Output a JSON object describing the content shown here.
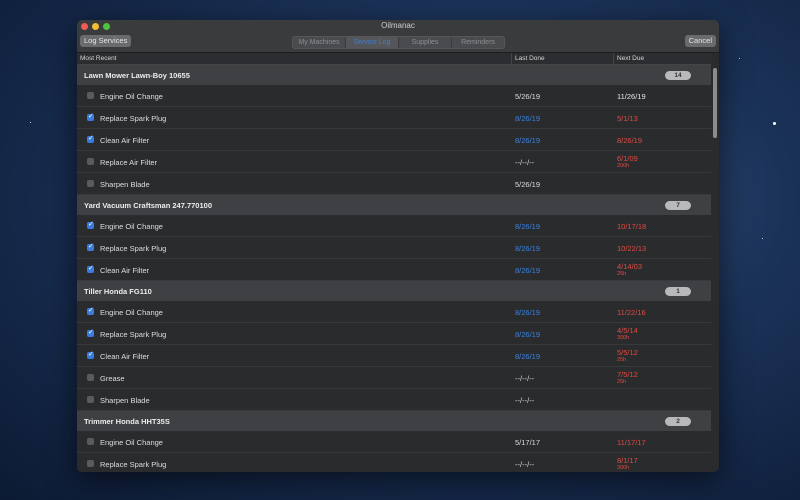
{
  "window": {
    "title": "Oilmanac"
  },
  "toolbar": {
    "log_services_label": "Log Services",
    "cancel_label": "Cancel",
    "tabs": [
      "My Machines",
      "Service Log",
      "Supplies",
      "Reminders"
    ]
  },
  "columns": {
    "most_recent": "Most Recent",
    "last_done": "Last Done",
    "next_due": "Next Due"
  },
  "groups": [
    {
      "title": "Lawn Mower   Lawn-Boy 10655",
      "badge": "14",
      "rows": [
        {
          "service": "Engine Oil Change",
          "checked": false,
          "last": "5/26/19",
          "next": "11/26/19",
          "next_color": "white"
        },
        {
          "service": "Replace Spark Plug",
          "checked": true,
          "last": "8/26/19",
          "next": "5/1/13",
          "next_color": "red"
        },
        {
          "service": "Clean Air Filter",
          "checked": true,
          "last": "8/26/19",
          "next": "8/26/19",
          "next_color": "red"
        },
        {
          "service": "Replace Air Filter",
          "checked": false,
          "last": "--/--/--",
          "next": "6/1/09",
          "next_sub": "200h",
          "next_color": "red"
        },
        {
          "service": "Sharpen Blade",
          "checked": false,
          "last": "5/26/19",
          "next": "",
          "next_color": "white"
        }
      ]
    },
    {
      "title": "Yard Vacuum   Craftsman 247.770100",
      "badge": "7",
      "rows": [
        {
          "service": "Engine Oil Change",
          "checked": true,
          "last": "8/26/19",
          "next": "10/17/18",
          "next_color": "red"
        },
        {
          "service": "Replace Spark Plug",
          "checked": true,
          "last": "8/26/19",
          "next": "10/22/13",
          "next_color": "red"
        },
        {
          "service": "Clean Air Filter",
          "checked": true,
          "last": "8/26/19",
          "next": "4/14/03",
          "next_sub": "25h",
          "next_color": "red"
        }
      ]
    },
    {
      "title": "Tiller   Honda FG110",
      "badge": "1",
      "rows": [
        {
          "service": "Engine Oil Change",
          "checked": true,
          "last": "8/26/19",
          "next": "11/22/16",
          "next_color": "red"
        },
        {
          "service": "Replace Spark Plug",
          "checked": true,
          "last": "8/26/19",
          "next": "4/5/14",
          "next_sub": "300h",
          "next_color": "red"
        },
        {
          "service": "Clean Air Filter",
          "checked": true,
          "last": "8/26/19",
          "next": "5/5/12",
          "next_sub": "25h",
          "next_color": "red"
        },
        {
          "service": "Grease",
          "checked": false,
          "last": "--/--/--",
          "next": "7/5/12",
          "next_sub": "25h",
          "next_color": "red"
        },
        {
          "service": "Sharpen Blade",
          "checked": false,
          "last": "--/--/--",
          "next": "",
          "next_color": "white"
        }
      ]
    },
    {
      "title": "Trimmer   Honda HHT35S",
      "badge": "2",
      "rows": [
        {
          "service": "Engine Oil Change",
          "checked": false,
          "last": "5/17/17",
          "next": "11/17/17",
          "next_color": "red"
        },
        {
          "service": "Replace Spark Plug",
          "checked": false,
          "last": "--/--/--",
          "next": "8/1/17",
          "next_sub": "300h",
          "next_color": "red"
        }
      ]
    }
  ],
  "colors": {
    "checked_blue": "#3a7be0",
    "overdue_red": "#e14a43",
    "recent_blue": "#3b82e0"
  }
}
